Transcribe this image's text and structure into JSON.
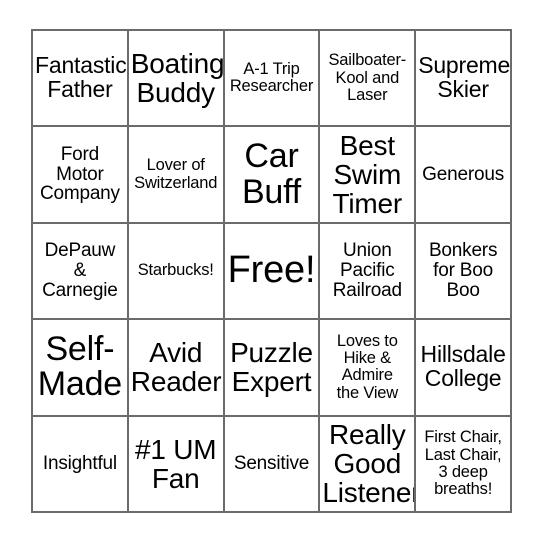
{
  "card": {
    "type": "bingo-card",
    "columns": 5,
    "rows": 5,
    "background_color": "#ffffff",
    "border_color": "#6b6b6b",
    "text_color": "#000000",
    "free_space_index": 12,
    "cells": [
      {
        "text": "Fantastic\nFather",
        "size": "l"
      },
      {
        "text": "Boating\nBuddy",
        "size": "xl"
      },
      {
        "text": "A-1 Trip\nResearcher",
        "size": "s"
      },
      {
        "text": "Sailboater-\nKool and\nLaser",
        "size": "s"
      },
      {
        "text": "Supreme\nSkier",
        "size": "l"
      },
      {
        "text": "Ford\nMotor\nCompany",
        "size": "m"
      },
      {
        "text": "Lover of\nSwitzerland",
        "size": "s"
      },
      {
        "text": "Car\nBuff",
        "size": "xxl"
      },
      {
        "text": "Best\nSwim\nTimer",
        "size": "xl"
      },
      {
        "text": "Generous",
        "size": "m"
      },
      {
        "text": "DePauw\n&\nCarnegie",
        "size": "m"
      },
      {
        "text": "Starbucks!",
        "size": "s"
      },
      {
        "text": "Free!",
        "size": "free"
      },
      {
        "text": "Union\nPacific\nRailroad",
        "size": "m"
      },
      {
        "text": "Bonkers\nfor Boo\nBoo",
        "size": "m"
      },
      {
        "text": "Self-\nMade",
        "size": "xxl"
      },
      {
        "text": "Avid\nReader",
        "size": "xl"
      },
      {
        "text": "Puzzle\nExpert",
        "size": "xl"
      },
      {
        "text": "Loves to\nHike &\nAdmire\nthe View",
        "size": "s"
      },
      {
        "text": "Hillsdale\nCollege",
        "size": "l"
      },
      {
        "text": "Insightful",
        "size": "m"
      },
      {
        "text": "#1 UM\nFan",
        "size": "xl"
      },
      {
        "text": "Sensitive",
        "size": "m"
      },
      {
        "text": "Really\nGood\nListener",
        "size": "xl"
      },
      {
        "text": "First Chair,\nLast Chair,\n3 deep\nbreaths!",
        "size": "s"
      }
    ]
  }
}
